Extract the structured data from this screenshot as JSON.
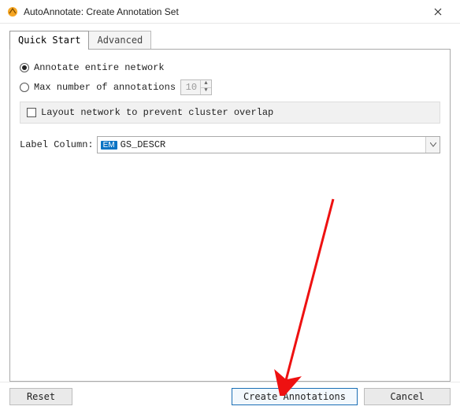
{
  "window": {
    "title": "AutoAnnotate: Create Annotation Set"
  },
  "tabs": {
    "quick_start": "Quick Start",
    "advanced": "Advanced"
  },
  "form": {
    "annotate_entire_label": "Annotate entire network",
    "max_annotations_label": "Max number of annotations",
    "max_annotations_value": "10",
    "layout_prevent_overlap_label": "Layout network to prevent cluster overlap",
    "label_column_label": "Label Column:",
    "label_column_badge": "EM",
    "label_column_value": "GS_DESCR"
  },
  "buttons": {
    "reset": "Reset",
    "create": "Create Annotations",
    "cancel": "Cancel"
  }
}
